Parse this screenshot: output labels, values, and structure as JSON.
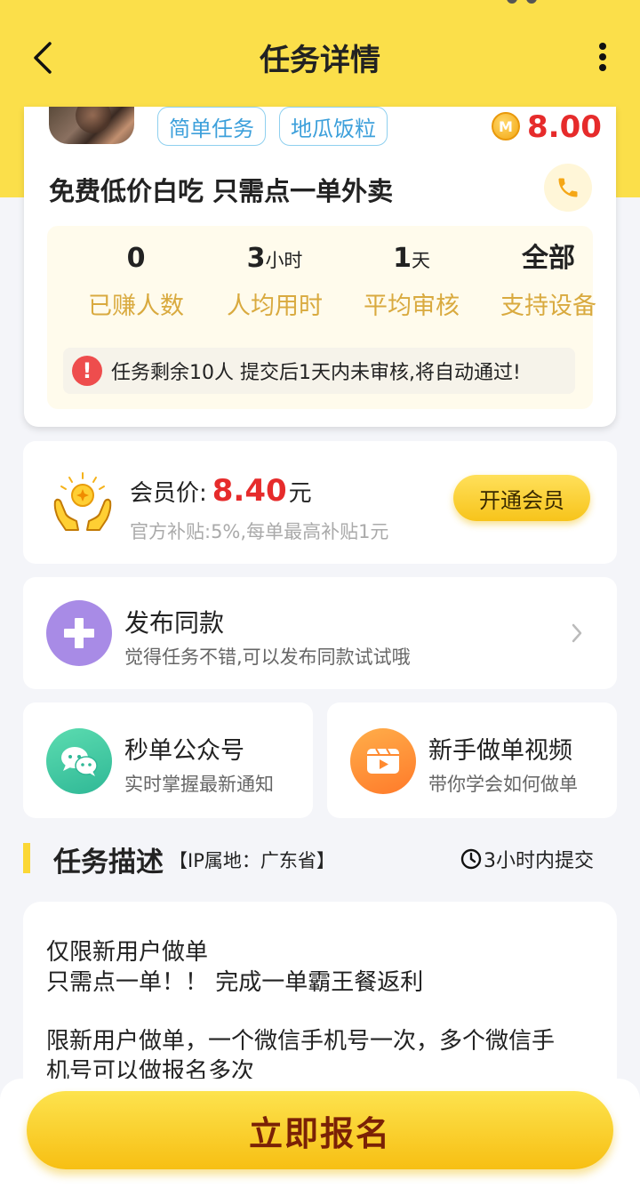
{
  "header": {
    "title": "任务详情"
  },
  "task": {
    "tags": [
      "简单任务",
      "地瓜饭粒"
    ],
    "coin_symbol": "M",
    "reward": "8.00",
    "title": "免费低价白吃  只需点一单外卖",
    "stats": [
      {
        "value": "0",
        "unit": "",
        "label": "已赚人数"
      },
      {
        "value": "3",
        "unit": "小时",
        "label": "人均用时"
      },
      {
        "value": "1",
        "unit": "天",
        "label": "平均审核"
      },
      {
        "value": "全部",
        "unit": "",
        "label": "支持设备"
      }
    ],
    "notice_icon": "!",
    "notice": "任务剩余10人  提交后1天内未审核,将自动通过!"
  },
  "vip": {
    "label": "会员价:",
    "price": "8.40",
    "unit": "元",
    "subtitle": "官方补贴:5%,每单最高补贴1元",
    "button": "开通会员"
  },
  "publish": {
    "title": "发布同款",
    "subtitle": "觉得任务不错,可以发布同款试试哦"
  },
  "shortcuts": [
    {
      "title": "秒单公众号",
      "subtitle": "实时掌握最新通知",
      "icon": "wechat-icon"
    },
    {
      "title": "新手做单视频",
      "subtitle": "带你学会如何做单",
      "icon": "video-icon"
    }
  ],
  "section": {
    "title": "任务描述",
    "ip": "【IP属地：广东省】",
    "deadline": "3小时内提交"
  },
  "description": {
    "lines": [
      "仅限新用户做单",
      "只需点一单！！ 完成一单霸王餐返利",
      "",
      "限新用户做单，一个微信手机号一次，多个微信手",
      "机号可以做报名多次"
    ]
  },
  "cta": {
    "label": "立即报名"
  },
  "colors": {
    "brand_yellow": "#fbdf4a",
    "price_red": "#e62b2b",
    "label_gold": "#d9aa3f",
    "tag_blue": "#3da0db"
  }
}
